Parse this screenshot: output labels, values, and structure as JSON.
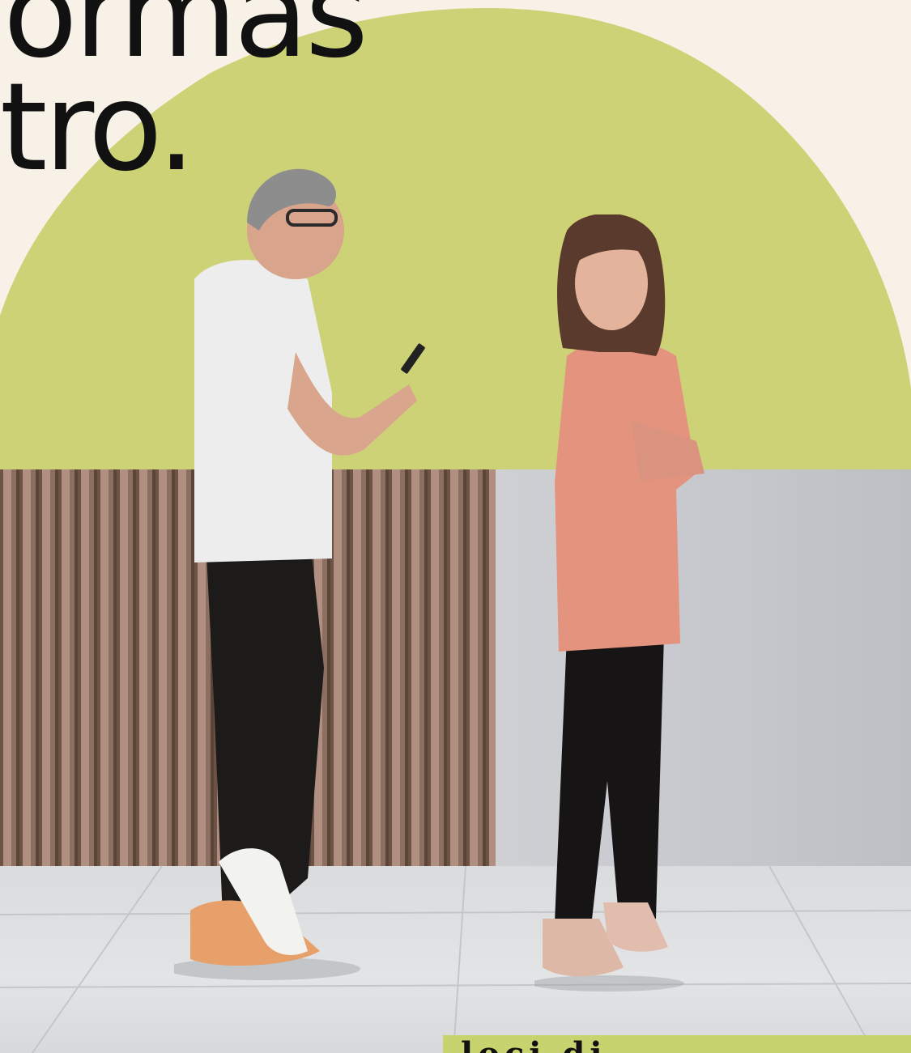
{
  "headline": {
    "line1": "ormas",
    "line2": "otro."
  },
  "badge": {
    "text": "loci           di"
  },
  "colors": {
    "background": "#f7f1e7",
    "arch": "#cdd276",
    "badge": "#c6d36e",
    "text": "#111111"
  }
}
